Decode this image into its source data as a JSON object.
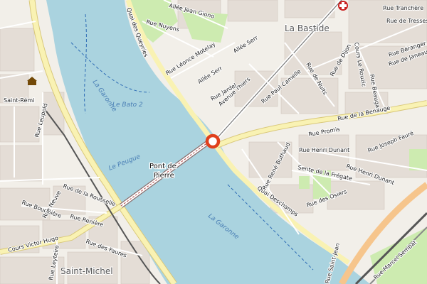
{
  "map": {
    "colors": {
      "river": "#aad3df",
      "land": "#f2efe9",
      "park": "#cdebb0",
      "major_road": "#f9f2b3",
      "road_casing": "#d9c87a",
      "railway": "#555555",
      "marker": "#e0401c",
      "building": "#d9d0c9"
    },
    "districts": [
      "La Bastide",
      "Saint-Michel"
    ],
    "bridge_label": [
      "Pont de",
      "Pierre"
    ],
    "water_labels": [
      "La Garonne",
      "La Garonne",
      "Le Peugue",
      "Le Bato 2"
    ],
    "streets": [
      "Allée Jean Giono",
      "Rue Nuyens",
      "Quai des Queyries",
      "Rue Léonce Motelay",
      "Allée Serr",
      "Allée Serr",
      "Avenue Thiers",
      "Rue Jardel",
      "Rue Paul Camelle",
      "Rue de Nuits",
      "Rue de Dijon",
      "Cours Le Rouzic",
      "Rue Beaugas",
      "Rue Béranger",
      "Rue de Janeau",
      "Rue Tranchère",
      "Rue de Tresses",
      "Rue de la Benauge",
      "Rue Promis",
      "Rue Henri Dunant",
      "Rue Joseph Fauré",
      "Rue Henri Dunant",
      "Sente de la Frégate",
      "Rue René Buthaud",
      "Quai Deschamps",
      "Rue des Osiers",
      "Rue Marcel Sembat",
      "Saint-Rémi",
      "Rue Leupold",
      "Rue de la Rousselle",
      "Rue Bouquière",
      "Rue Neuve",
      "Rue Renière",
      "Cours Victor Hugo",
      "Rue des Faures",
      "Rue Leyteire",
      "Rue Saint-Jean"
    ],
    "icons": [
      "location-marker-icon",
      "pharmacy-cross-icon",
      "museum-icon"
    ]
  }
}
